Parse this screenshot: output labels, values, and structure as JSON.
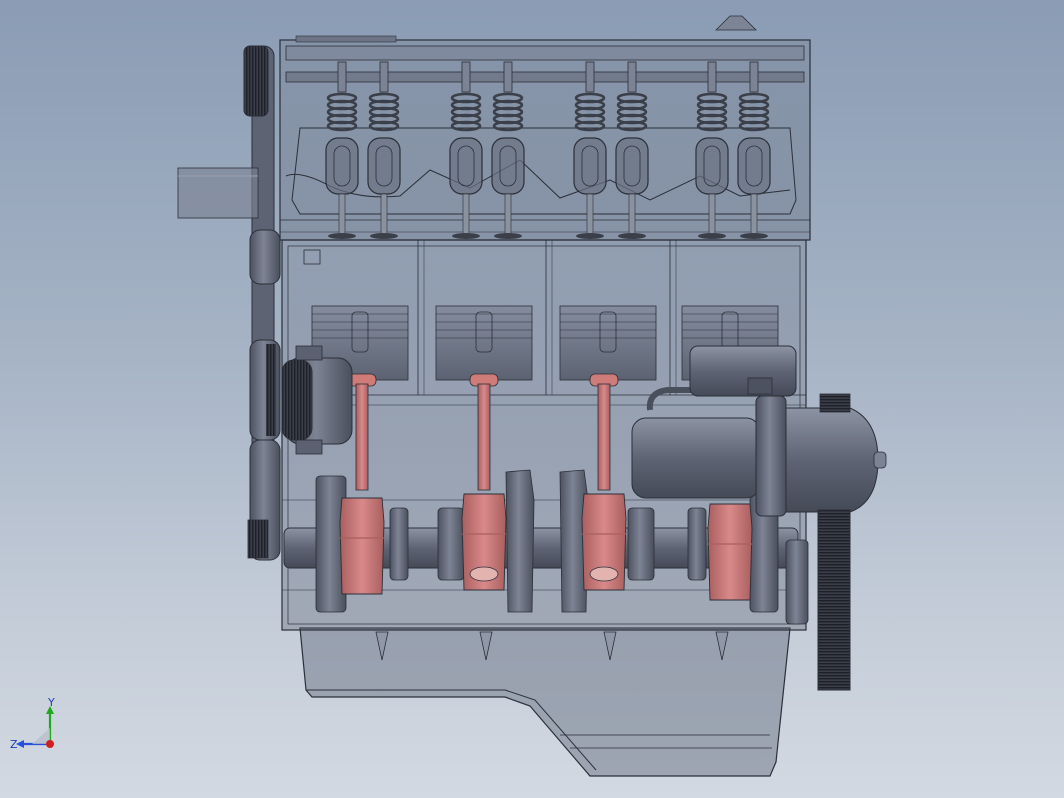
{
  "viewport": {
    "background_top": "#8a9cb4",
    "background_bottom": "#d3d9e2"
  },
  "model": {
    "cylinders": 4,
    "body_color": "#6c7486",
    "part_color": "#5c6272",
    "linework_color": "#2b2f38",
    "rod_color": "#cf7b78",
    "rod_dark_color": "#a95f5e",
    "spring_color": "#8a8f9c"
  },
  "triad": {
    "x_label": "",
    "y_label": "Y",
    "z_label": "Z",
    "x_color": "#d11f1f",
    "y_color": "#1ea81e",
    "z_color": "#2a4fd8"
  }
}
